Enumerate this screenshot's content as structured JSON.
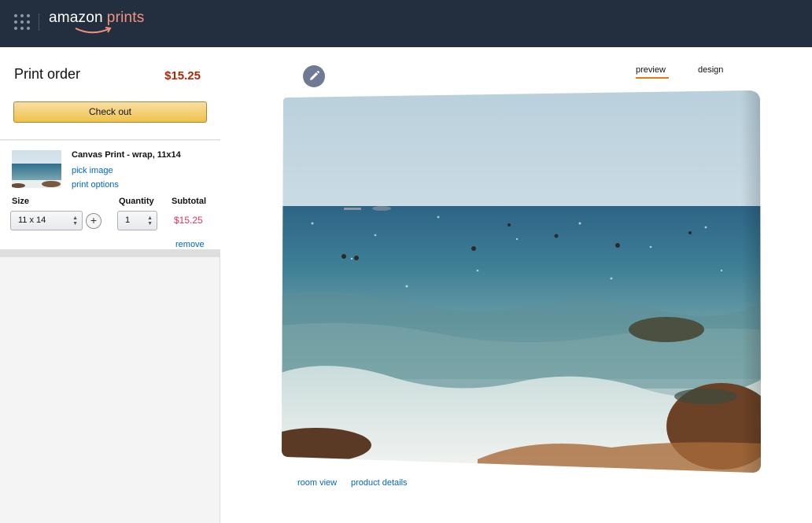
{
  "header": {
    "logo_amazon": "amazon",
    "logo_prints": "prints",
    "logo_smile_color": "#f3947c",
    "background": "#232f3e",
    "apps_icon": "apps-grid-icon"
  },
  "order": {
    "title": "Print order",
    "total": "$15.25",
    "checkout_label": "Check out"
  },
  "item": {
    "title": "Canvas Print - wrap, 11x14",
    "pick_image": "pick image",
    "print_options": "print options",
    "size_label": "Size",
    "quantity_label": "Quantity",
    "subtotal_label": "Subtotal",
    "size_value": "11 x 14",
    "quantity_value": "1",
    "subtotal": "$15.25",
    "remove": "remove",
    "add_icon": "plus-icon"
  },
  "main": {
    "edit_icon": "pencil-icon",
    "tabs": [
      {
        "label": "preview",
        "active": true
      },
      {
        "label": "design",
        "active": false
      }
    ],
    "links": {
      "room_view": "room view",
      "product_details": "product details"
    }
  },
  "colors": {
    "accent_orange": "#e47911",
    "price_red": "#b12704",
    "subtotal_pink": "#e0335a",
    "link_blue": "#0066c0"
  }
}
